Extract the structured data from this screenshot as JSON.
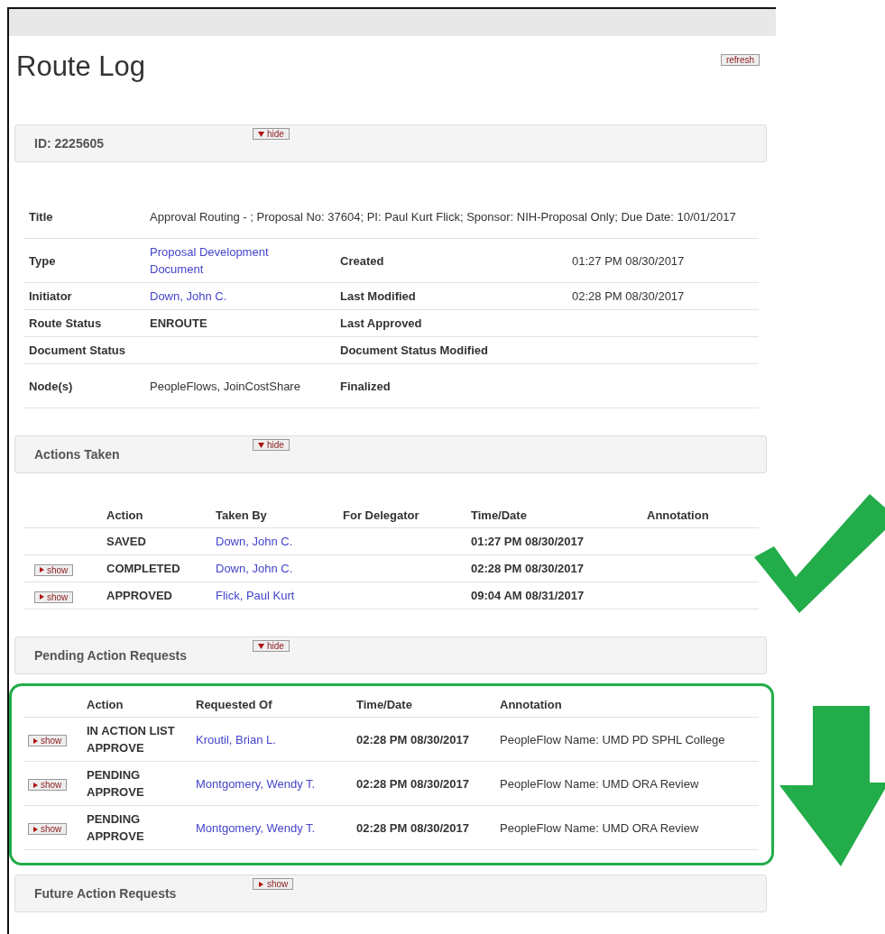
{
  "title": "Route Log",
  "refresh_button": "refresh",
  "document_section": {
    "heading": "ID: 2225605",
    "toggle": {
      "label": "hide",
      "expanded": true
    },
    "rows": [
      {
        "cells": [
          {
            "label": "Title",
            "value": "Approval Routing - ; Proposal No: 37604; PI: Paul Kurt Flick; Sponsor: NIH-Proposal Only; Due Date: 10/01/2017",
            "kind": "plain"
          }
        ]
      },
      {
        "cells": [
          {
            "label": "Type",
            "value": "Proposal Development Document",
            "kind": "link"
          },
          {
            "label": "Created",
            "value": "01:27 PM 08/30/2017",
            "kind": "plain"
          }
        ]
      },
      {
        "cells": [
          {
            "label": "Initiator",
            "value": "Down, John C.",
            "kind": "link"
          },
          {
            "label": "Last Modified",
            "value": "02:28 PM 08/30/2017",
            "kind": "plain"
          }
        ]
      },
      {
        "cells": [
          {
            "label": "Route Status",
            "value": "ENROUTE",
            "kind": "bold"
          },
          {
            "label": "Last Approved"
          }
        ]
      },
      {
        "cells": [
          {
            "label": "Document Status"
          },
          {
            "label": "Document Status Modified"
          }
        ]
      },
      {
        "cells": [
          {
            "label": "Node(s)",
            "value": "PeopleFlows, JoinCostShare",
            "kind": "plain"
          },
          {
            "label": "Finalized"
          }
        ]
      }
    ]
  },
  "actions_taken": {
    "heading": "Actions Taken",
    "toggle": {
      "label": "hide",
      "expanded": true
    },
    "columns": [
      "Action",
      "Taken By",
      "For Delegator",
      "Time/Date",
      "Annotation"
    ],
    "rows": [
      {
        "action": "SAVED",
        "by": "Down, John C.",
        "time": "01:27 PM 08/30/2017"
      },
      {
        "show": "show",
        "action": "COMPLETED",
        "by": "Down, John C.",
        "time": "02:28 PM 08/30/2017"
      },
      {
        "show": "show",
        "action": "APPROVED",
        "by": "Flick, Paul Kurt",
        "time": "09:04 AM 08/31/2017"
      }
    ]
  },
  "pending_action_requests": {
    "heading": "Pending Action Requests",
    "toggle": {
      "label": "hide",
      "expanded": true
    },
    "highlighted": true,
    "columns": [
      "Action",
      "Requested Of",
      "Time/Date",
      "Annotation"
    ],
    "rows": [
      {
        "show": "show",
        "action": "IN ACTION LIST APPROVE",
        "by": "Kroutil, Brian L.",
        "time": "02:28 PM 08/30/2017",
        "annotation": "PeopleFlow Name: UMD PD SPHL College"
      },
      {
        "show": "show",
        "action": "PENDING APPROVE",
        "by": "Montgomery, Wendy T.",
        "time": "02:28 PM 08/30/2017",
        "annotation": "PeopleFlow Name: UMD ORA Review"
      },
      {
        "show": "show",
        "action": "PENDING APPROVE",
        "by": "Montgomery, Wendy T.",
        "time": "02:28 PM 08/30/2017",
        "annotation": "PeopleFlow Name: UMD ORA Review"
      }
    ]
  },
  "future_action_requests": {
    "heading": "Future Action Requests",
    "toggle": {
      "label": "show",
      "expanded": false
    }
  },
  "annotations": [
    {
      "kind": "checkmark",
      "color": "#22ac4a"
    },
    {
      "kind": "down-arrow",
      "color": "#22ac4a"
    }
  ]
}
